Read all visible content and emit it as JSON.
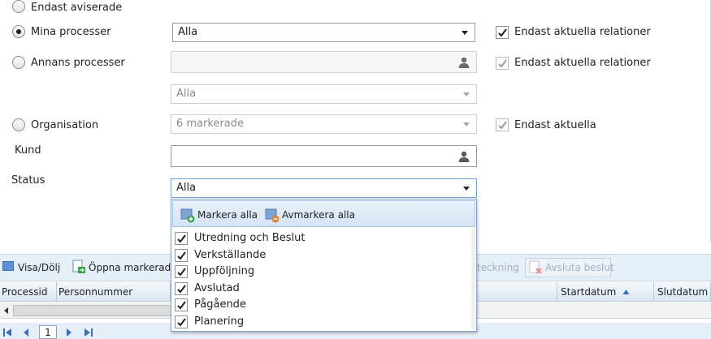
{
  "filters": {
    "endast_aviserade": "Endast aviserade",
    "mina_processer": "Mina processer",
    "mina_processer_value": "Alla",
    "annans_processer": "Annans processer",
    "annans_sub_value": "Alla",
    "organisation": "Organisation",
    "organisation_value": "6 markerade",
    "kund": "Kund",
    "status": "Status",
    "status_value": "Alla",
    "endast_aktuella_relationer_1": "Endast aktuella relationer",
    "endast_aktuella_relationer_2": "Endast aktuella relationer",
    "endast_aktuella": "Endast aktuella"
  },
  "status_popup": {
    "mark_all": "Markera alla",
    "unmark_all": "Avmarkera alla",
    "options": [
      {
        "label": "Utredning och Beslut",
        "checked": true
      },
      {
        "label": "Verkställande",
        "checked": true
      },
      {
        "label": "Uppföljning",
        "checked": true
      },
      {
        "label": "Avslutad",
        "checked": true
      },
      {
        "label": "Pågående",
        "checked": true
      },
      {
        "label": "Planering",
        "checked": true
      }
    ]
  },
  "toolbar": {
    "visa_dolj": "Visa/Dölj",
    "oppna_markerad": "Öppna markerad",
    "partial_teckning": "teckning",
    "avsluta_beslut": "Avsluta beslut"
  },
  "grid": {
    "columns": [
      "Processid",
      "Personnummer",
      "Startdatum",
      "Slutdatum"
    ]
  },
  "pager": {
    "current_page": "1"
  },
  "colors": {
    "toolbar_bg": "#e6eef7",
    "popup_header_bg": "#d5e3f3",
    "border_blue": "#8aa2c0"
  }
}
